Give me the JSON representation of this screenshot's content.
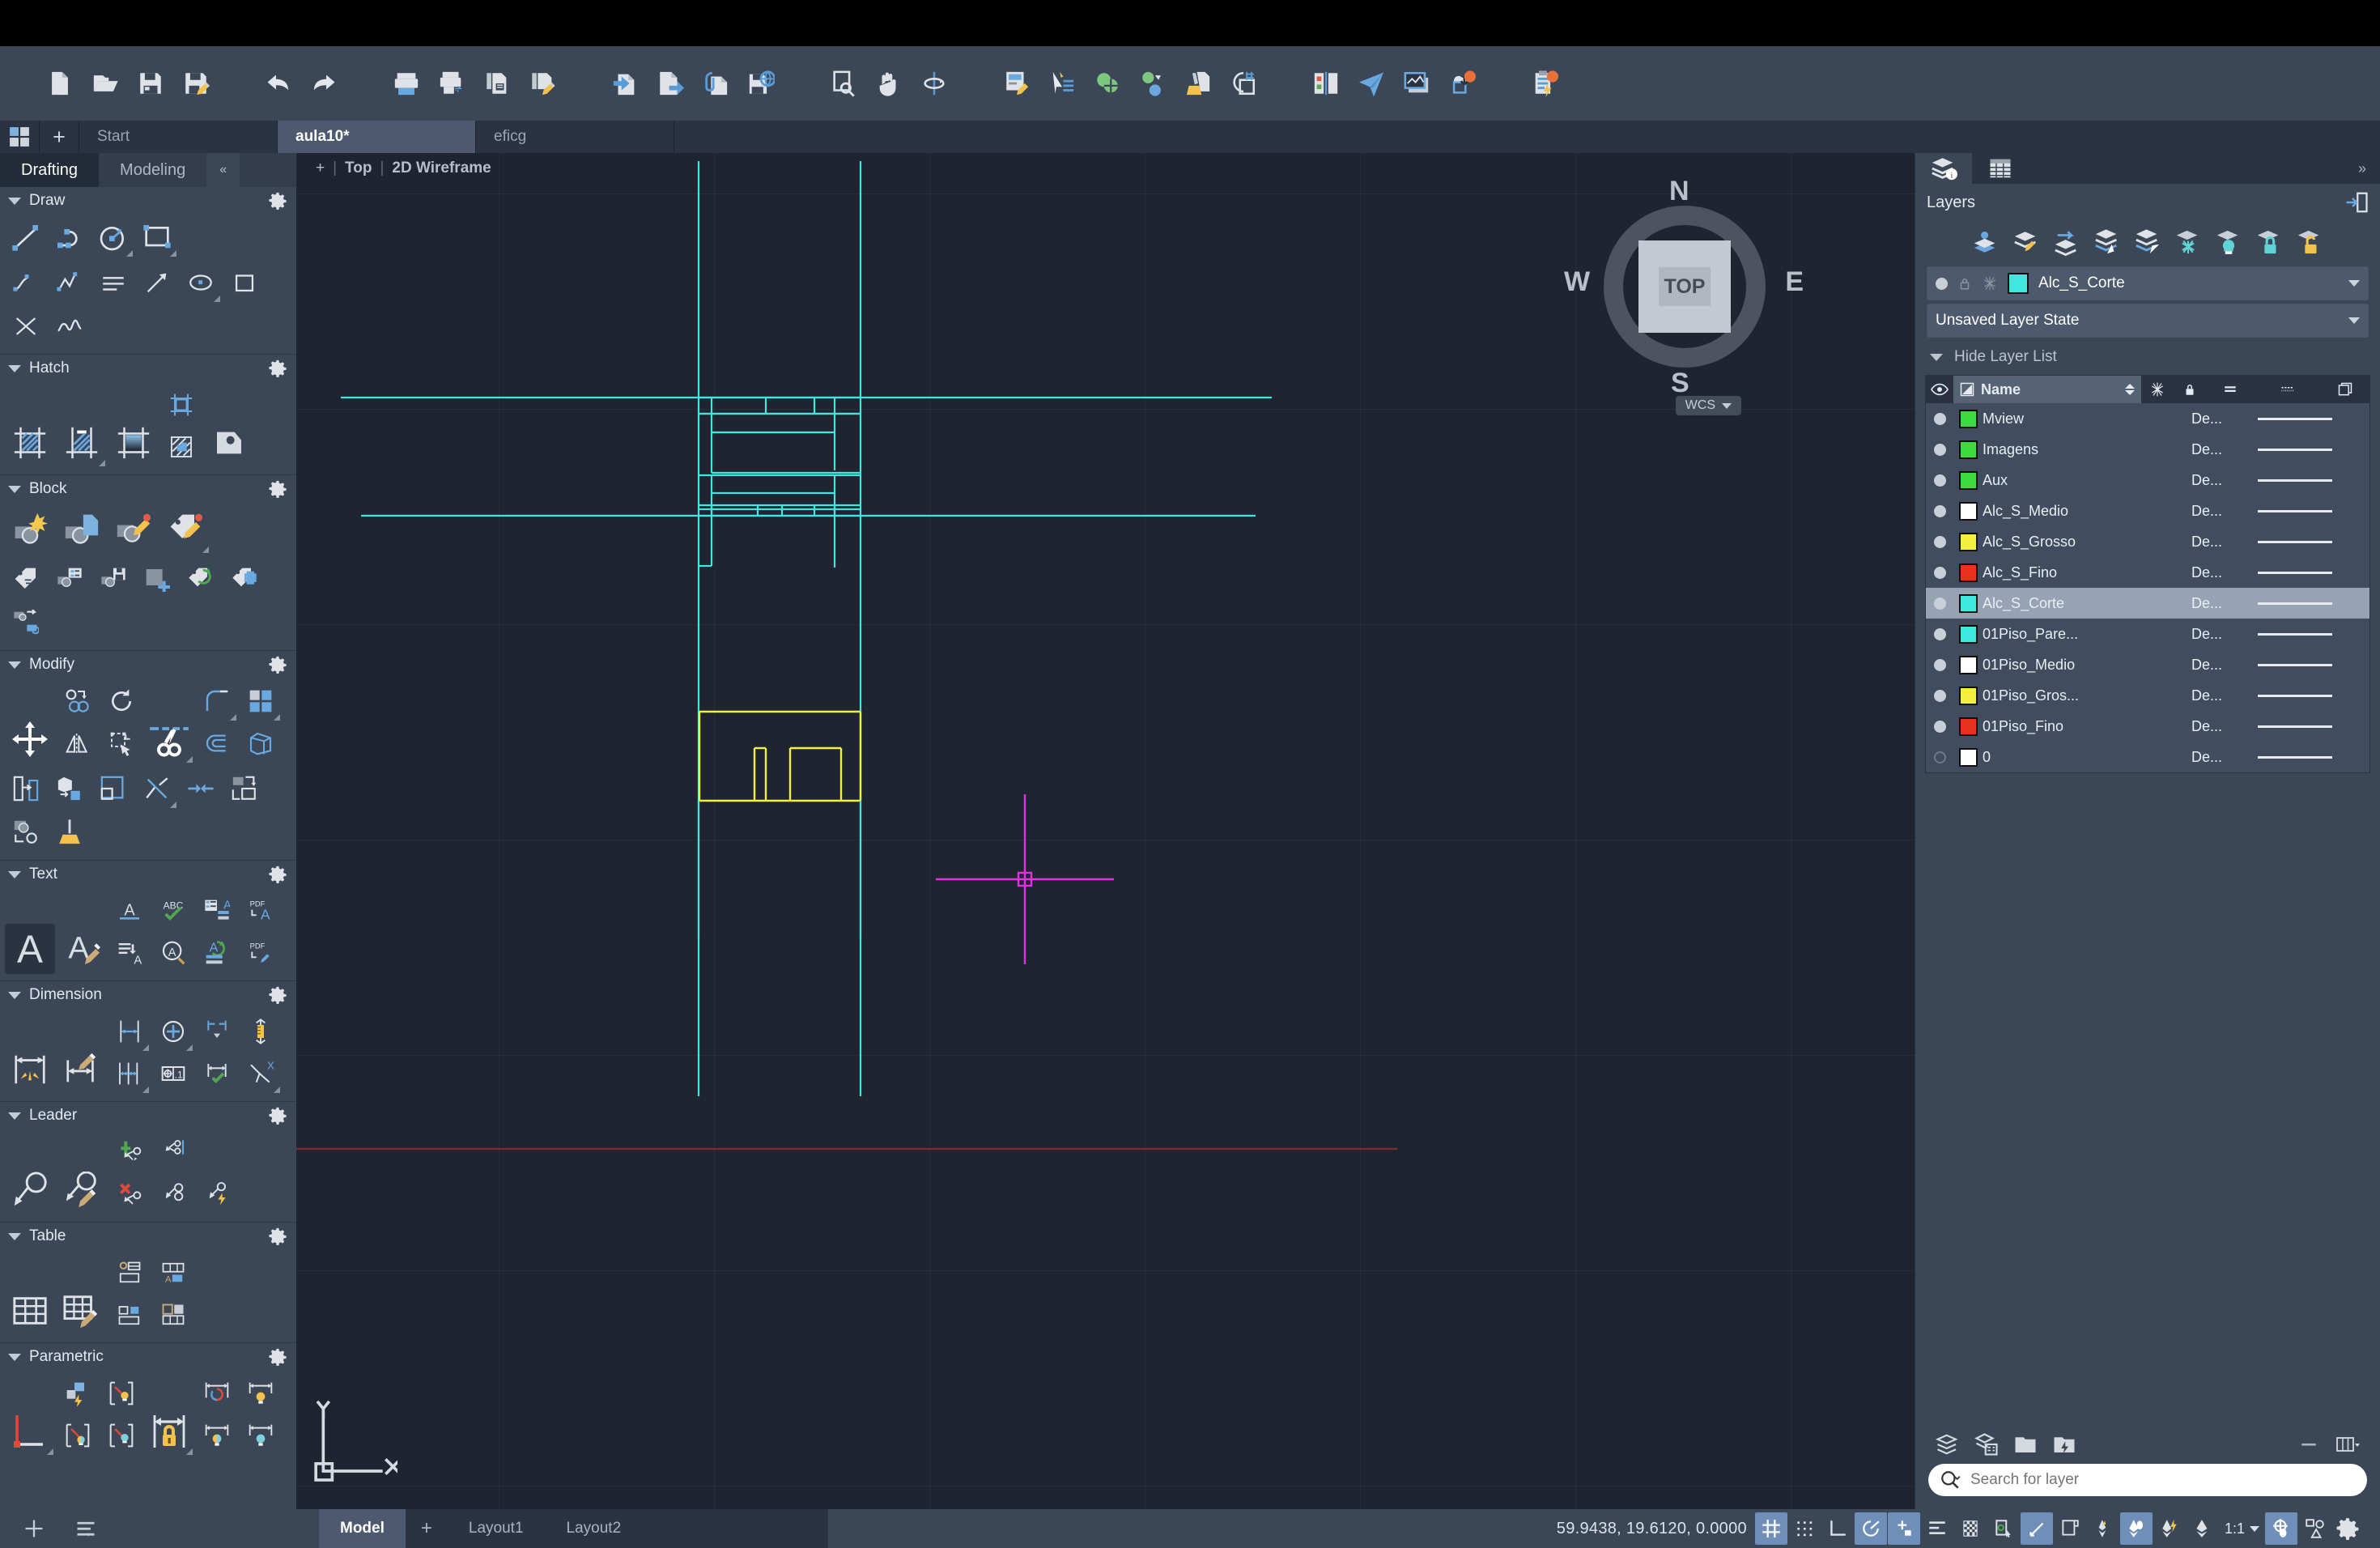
{
  "toolbar": {
    "groups": [
      {
        "name": "file",
        "buttons": [
          {
            "id": "new",
            "label": "New",
            "icon": "new-file-icon"
          },
          {
            "id": "open",
            "label": "Open",
            "icon": "open-folder-icon"
          },
          {
            "id": "save",
            "label": "Save",
            "icon": "save-icon"
          },
          {
            "id": "saveas",
            "label": "Save As",
            "icon": "save-as-icon"
          }
        ]
      },
      {
        "name": "undo-redo",
        "buttons": [
          {
            "id": "undo",
            "label": "Undo",
            "icon": "undo-arrow-icon"
          },
          {
            "id": "redo",
            "label": "Redo",
            "icon": "redo-arrow-icon"
          }
        ]
      },
      {
        "name": "print",
        "buttons": [
          {
            "id": "plot",
            "label": "Plot",
            "icon": "printer-icon"
          },
          {
            "id": "batch-plot",
            "label": "Batch Plot",
            "icon": "printer-export-icon"
          },
          {
            "id": "page-setup",
            "label": "Page Setup",
            "icon": "page-setup-icon"
          },
          {
            "id": "plot-style",
            "label": "Plot Style Edit",
            "icon": "plot-style-edit-icon"
          }
        ]
      },
      {
        "name": "import-export",
        "buttons": [
          {
            "id": "import",
            "label": "Import",
            "icon": "import-file-icon"
          },
          {
            "id": "export",
            "label": "Export",
            "icon": "export-file-icon"
          },
          {
            "id": "attach",
            "label": "Attach",
            "icon": "attach-clip-icon"
          },
          {
            "id": "save-web",
            "label": "Save to Web",
            "icon": "save-web-icon"
          }
        ]
      },
      {
        "name": "view-nav",
        "buttons": [
          {
            "id": "zoom-window",
            "label": "Zoom Window",
            "icon": "zoom-window-icon"
          },
          {
            "id": "pan",
            "label": "Pan",
            "icon": "pan-hand-icon"
          },
          {
            "id": "orbit",
            "label": "Orbit",
            "icon": "orbit-icon"
          }
        ]
      },
      {
        "name": "props",
        "buttons": [
          {
            "id": "properties",
            "label": "Properties",
            "icon": "properties-icon"
          },
          {
            "id": "quick-props",
            "label": "Quick Properties",
            "icon": "quick-select-icon"
          },
          {
            "id": "group",
            "label": "Group",
            "icon": "group-objects-icon"
          },
          {
            "id": "point-style",
            "label": "Point Style",
            "icon": "point-style-icon"
          },
          {
            "id": "purge",
            "label": "Purge",
            "icon": "purge-broom-icon"
          },
          {
            "id": "units",
            "label": "Units",
            "icon": "units-icon"
          }
        ]
      },
      {
        "name": "share",
        "buttons": [
          {
            "id": "compare",
            "label": "DWG Compare",
            "icon": "dwg-compare-icon"
          },
          {
            "id": "send",
            "label": "Send",
            "icon": "send-plane-icon"
          },
          {
            "id": "views",
            "label": "Views",
            "icon": "views-icon"
          },
          {
            "id": "cloud-save",
            "label": "Cloud Save",
            "icon": "cloud-download-icon"
          }
        ]
      },
      {
        "name": "notify",
        "buttons": [
          {
            "id": "tasks",
            "label": "Tasks",
            "icon": "clipboard-bolt-icon"
          }
        ]
      }
    ]
  },
  "doc_tabs": {
    "app_button": "app-grid-icon",
    "new_tab": "+",
    "tabs": [
      {
        "label": "Start",
        "active": false
      },
      {
        "label": "aula10*",
        "active": true
      },
      {
        "label": "eficg",
        "active": false
      }
    ]
  },
  "ribbon": {
    "tabs": [
      {
        "label": "Drafting",
        "active": true
      },
      {
        "label": "Modeling",
        "active": false
      }
    ],
    "collapse_label": "«",
    "panels": [
      {
        "title": "Draw",
        "gear": "gear-icon",
        "rows": [
          [
            "line-icon",
            "arc-icon",
            "circle-icon",
            "rectangle-icon"
          ],
          [
            "spline-icon",
            "polyline-icon",
            "multiline-icon",
            "ray-icon",
            "ellipse-icon",
            "polygon-icon",
            "construction-line-icon",
            "revision-cloud-icon"
          ]
        ]
      },
      {
        "title": "Hatch",
        "gear": "gear-icon",
        "rows": [
          [
            "hatch-icon",
            "hatch-edit-icon",
            "gradient-icon",
            "boundary-icon",
            "region-icon",
            "hatch-set-origin-icon"
          ]
        ]
      },
      {
        "title": "Block",
        "gear": "gear-icon",
        "rows": [
          [
            "create-block-icon",
            "insert-block-icon",
            "block-editor-icon",
            "define-attribute-icon"
          ],
          [
            "attribute-icon",
            "block-attribute-manager-icon",
            "write-block-icon",
            "add-block-icon",
            "sync-attributes-icon",
            "block-array-icon",
            "block-replace-icon"
          ]
        ]
      },
      {
        "title": "Modify",
        "gear": "gear-icon",
        "rows": [
          [
            "move-icon",
            "copy-icon",
            "rotate-icon",
            "trim-icon",
            "fillet-icon",
            "array-icon"
          ],
          [
            "mirror-icon",
            "stretch-icon",
            "extend-icon",
            "offset-icon",
            "3d-solid-icon"
          ],
          [
            "taper-icon",
            "extrude-icon",
            "scale-icon",
            "explode-icon",
            "join-icon",
            "align-icon",
            "chamfer-icon",
            "erase-broom-icon"
          ]
        ]
      },
      {
        "title": "Text",
        "gear": "gear-icon",
        "rows": [
          [
            "multiline-text-icon",
            "text-style-icon",
            "single-line-text-icon",
            "spell-check-icon",
            "text-field-icon",
            "pdf-text-icon"
          ],
          [
            "text-align-icon",
            "find-text-icon",
            "text-update-icon",
            "pdf-convert-icon"
          ]
        ]
      },
      {
        "title": "Dimension",
        "gear": "gear-icon",
        "rows": [
          [
            "dimension-icon",
            "dimension-style-icon",
            "linear-dim-icon",
            "center-mark-icon",
            "continue-dim-icon",
            "dim-scale-icon"
          ],
          [
            "baseline-dim-icon",
            "tolerance-icon",
            "dim-check-icon",
            "oblique-dim-icon"
          ]
        ]
      },
      {
        "title": "Leader",
        "gear": "gear-icon",
        "rows": [
          [
            "multileader-icon",
            "multileader-style-icon",
            "add-leader-icon",
            "align-leader-icon",
            "leader-quick-icon"
          ],
          [
            "remove-leader-icon",
            "collect-leader-icon"
          ]
        ]
      },
      {
        "title": "Table",
        "gear": "gear-icon",
        "rows": [
          [
            "table-icon",
            "table-style-icon",
            "insert-row-icon",
            "merge-cell-icon",
            "table-cell-icon",
            "table-data-icon"
          ]
        ]
      },
      {
        "title": "Parametric",
        "gear": "gear-icon",
        "rows": [
          [
            "geometric-constraint-icon",
            "auto-constrain-icon",
            "show-constraint-icon",
            "dimensional-constraint-icon",
            "constraint-settings-icon",
            "dim-constraint-show-icon"
          ],
          [
            "hide-constraint-icon",
            "constraint-bar-icon",
            "lock-constraint-icon",
            "param-manager-icon",
            "param-hide-icon"
          ]
        ]
      }
    ]
  },
  "viewport": {
    "add_label": "+",
    "view_label": "Top",
    "visual_style_label": "2D Wireframe",
    "separator": "|",
    "viewcube": {
      "face": "TOP",
      "north": "N",
      "east": "E",
      "south": "S",
      "west": "W"
    },
    "ucs": {
      "label": "WCS"
    },
    "ucs_icon": {
      "x_label": "X",
      "y_label": "Y"
    },
    "crosshair_color": "#e32ee3"
  },
  "layers_panel": {
    "tabs": [
      {
        "icon": "layers-info-icon",
        "active": true
      },
      {
        "icon": "table-grid-icon",
        "active": false
      }
    ],
    "expand_icon": "»",
    "title": "Layers",
    "dock_icon": "dock-panel-icon",
    "tools": [
      {
        "icon": "layer-make-current-icon",
        "label": "Make Current"
      },
      {
        "icon": "layer-match-icon",
        "label": "Match Layer"
      },
      {
        "icon": "layer-previous-icon",
        "label": "Previous Layer"
      },
      {
        "icon": "layer-isolate-icon",
        "label": "Isolate"
      },
      {
        "icon": "layer-unisolate-icon",
        "label": "Unisolate"
      },
      {
        "icon": "layer-freeze-icon",
        "label": "Freeze"
      },
      {
        "icon": "layer-off-icon",
        "label": "Layer Off"
      },
      {
        "icon": "layer-lock-icon",
        "label": "Lock"
      },
      {
        "icon": "layer-unlock-icon",
        "label": "Unlock"
      }
    ],
    "current_layer": {
      "name": "Alc_S_Corte",
      "color": "#3ee8e0",
      "on_icon": "layer-on-dot",
      "lock_icon": "lock-icon",
      "freeze_icon": "freeze-icon"
    },
    "layer_state": "Unsaved Layer State",
    "hide_layer_list": "Hide Layer List",
    "columns": [
      {
        "key": "visible",
        "icon": "eye-icon",
        "label": ""
      },
      {
        "key": "name",
        "icon": "name-sort-icon",
        "label": "Name"
      },
      {
        "key": "freeze",
        "icon": "freeze-icon",
        "label": ""
      },
      {
        "key": "lock",
        "icon": "lock-icon",
        "label": ""
      },
      {
        "key": "color",
        "icon": "color-bars-icon",
        "label": ""
      },
      {
        "key": "linetype",
        "icon": "linetype-icon",
        "label": ""
      },
      {
        "key": "plot",
        "icon": "plot-icon",
        "label": ""
      }
    ],
    "rows": [
      {
        "name": "Mview",
        "color": "#3ddb3d",
        "on": true,
        "plot": "De...",
        "linetype": "solid",
        "selected": false
      },
      {
        "name": "Imagens",
        "color": "#3ddb3d",
        "on": true,
        "plot": "De...",
        "linetype": "solid",
        "selected": false
      },
      {
        "name": "Aux",
        "color": "#3ddb3d",
        "on": true,
        "plot": "De...",
        "linetype": "solid",
        "selected": false
      },
      {
        "name": "Alc_S_Medio",
        "color": "#ffffff",
        "on": true,
        "plot": "De...",
        "linetype": "solid",
        "selected": false
      },
      {
        "name": "Alc_S_Grosso",
        "color": "#f5ef3f",
        "on": true,
        "plot": "De...",
        "linetype": "solid",
        "selected": false
      },
      {
        "name": "Alc_S_Fino",
        "color": "#e8331c",
        "on": true,
        "plot": "De...",
        "linetype": "solid",
        "selected": false
      },
      {
        "name": "Alc_S_Corte",
        "color": "#3ee8e0",
        "on": true,
        "plot": "De...",
        "linetype": "solid",
        "selected": true
      },
      {
        "name": "01Piso_Pare...",
        "color": "#3ee8e0",
        "on": true,
        "plot": "De...",
        "linetype": "solid",
        "selected": false
      },
      {
        "name": "01Piso_Medio",
        "color": "#ffffff",
        "on": true,
        "plot": "De...",
        "linetype": "solid",
        "selected": false
      },
      {
        "name": "01Piso_Gros...",
        "color": "#f5ef3f",
        "on": true,
        "plot": "De...",
        "linetype": "solid",
        "selected": false
      },
      {
        "name": "01Piso_Fino",
        "color": "#e8331c",
        "on": true,
        "plot": "De...",
        "linetype": "solid",
        "selected": false
      },
      {
        "name": "0",
        "color": "#ffffff",
        "on": false,
        "plot": "De...",
        "linetype": "solid",
        "selected": false
      }
    ],
    "bottom_tools": [
      {
        "icon": "new-layer-icon",
        "label": "New Layer"
      },
      {
        "icon": "layer-properties-icon",
        "label": "Layer Properties"
      },
      {
        "icon": "layer-group-icon",
        "label": "New Group Filter"
      },
      {
        "icon": "layer-filter-icon",
        "label": "New Property Filter"
      }
    ],
    "collapse_icon": "minimize-icon",
    "columns_icon": "column-settings-icon",
    "search": {
      "placeholder": "Search for layer",
      "value": "",
      "icon": "search-icon"
    }
  },
  "status_bar": {
    "left_tools": [
      {
        "icon": "add-icon",
        "label": "Add"
      },
      {
        "icon": "menu-list-icon",
        "label": "Menu"
      }
    ],
    "model_tabs": [
      {
        "label": "Model",
        "active": true
      },
      {
        "label": "+",
        "active": false,
        "is_add": true
      },
      {
        "label": "Layout1",
        "active": false
      },
      {
        "label": "Layout2",
        "active": false
      }
    ],
    "coordinates": "59.9438, 19.6120, 0.0000",
    "toggles": [
      {
        "icon": "grid-icon",
        "label": "Grid Display",
        "on": true
      },
      {
        "icon": "snap-icon",
        "label": "Snap Mode",
        "on": false
      },
      {
        "icon": "ortho-icon",
        "label": "Ortho Mode",
        "on": false
      },
      {
        "icon": "polar-icon",
        "label": "Polar Tracking",
        "on": true
      },
      {
        "icon": "osnap-icon",
        "label": "Object Snap",
        "on": true
      },
      {
        "icon": "otrack-icon",
        "label": "Object Snap Tracking",
        "on": false
      },
      {
        "icon": "transparency-icon",
        "label": "Transparency",
        "on": false
      },
      {
        "icon": "dyn-ucs-icon",
        "label": "Dynamic UCS",
        "on": false
      },
      {
        "icon": "dyn-input-icon",
        "label": "Dynamic Input",
        "on": true
      },
      {
        "icon": "lineweight-icon",
        "label": "Show Lineweight",
        "on": false
      },
      {
        "icon": "annotation-visibility-icon",
        "label": "Annotation Visibility",
        "on": false
      }
    ],
    "annotation_tools": [
      {
        "icon": "annoscale-auto-icon",
        "label": "Auto Scale",
        "on": true
      },
      {
        "icon": "annoscale-sync-icon",
        "label": "Sync Scale",
        "on": false
      },
      {
        "icon": "annoscale-icon",
        "label": "Annotation Scale",
        "on": false
      }
    ],
    "scale": "1:1",
    "right_tools": [
      {
        "icon": "workspace-icon",
        "label": "Workspace Switching",
        "on": true
      },
      {
        "icon": "hardware-accel-icon",
        "label": "Isolate Objects",
        "on": false
      },
      {
        "icon": "customize-gear-icon",
        "label": "Customization",
        "on": false
      }
    ]
  }
}
